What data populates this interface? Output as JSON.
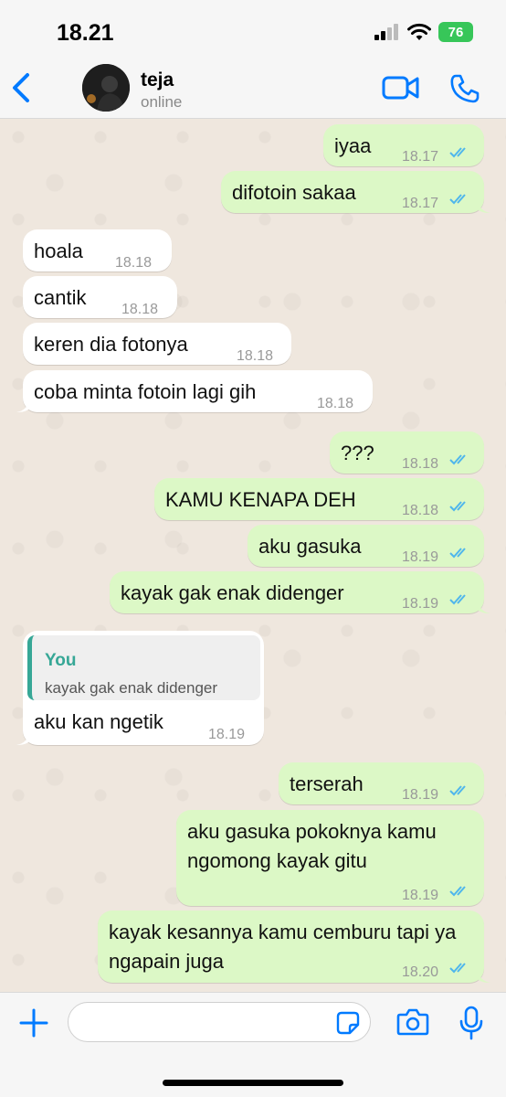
{
  "status_bar": {
    "time": "18.21",
    "battery": "76"
  },
  "header": {
    "contact_name": "teja",
    "contact_status": "online"
  },
  "messages": [
    {
      "text": "iyaa",
      "time": "18.17"
    },
    {
      "text": "difotoin sakaa",
      "time": "18.17"
    },
    {
      "text": "hoala",
      "time": "18.18"
    },
    {
      "text": "cantik",
      "time": "18.18"
    },
    {
      "text": "keren dia fotonya",
      "time": "18.18"
    },
    {
      "text": "coba minta fotoin lagi gih",
      "time": "18.18"
    },
    {
      "text": "???",
      "time": "18.18"
    },
    {
      "text": "KAMU KENAPA DEH",
      "time": "18.18"
    },
    {
      "text": "aku gasuka",
      "time": "18.19"
    },
    {
      "text": "kayak gak enak didenger",
      "time": "18.19"
    },
    {
      "reply_author": "You",
      "reply_text": "kayak gak enak didenger",
      "text": "aku kan ngetik",
      "time": "18.19"
    },
    {
      "text": "terserah",
      "time": "18.19"
    },
    {
      "text": "aku gasuka pokoknya kamu ngomong kayak gitu",
      "time": "18.19"
    },
    {
      "text": "kayak kesannya kamu cemburu tapi ya ngapain juga",
      "time": "18.20"
    }
  ],
  "input": {
    "value": "",
    "placeholder": ""
  },
  "colors": {
    "accent": "#007aff",
    "outgoing_bubble": "#dcf8c6",
    "incoming_bubble": "#ffffff",
    "read_ticks": "#4fb6ec",
    "reply_accent": "#36a796"
  }
}
